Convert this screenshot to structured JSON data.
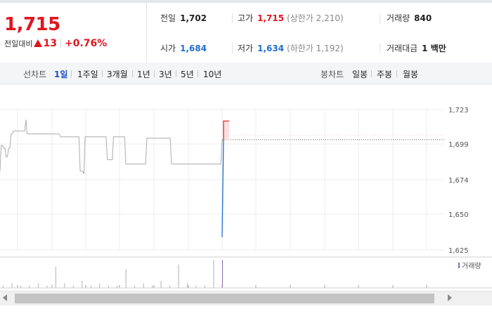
{
  "quote": {
    "price": "1,715",
    "change_label": "전일대비",
    "change_amount": "13",
    "change_pct": "+0.76%",
    "colors": {
      "up": "#e0151e",
      "down": "#1f6fd1"
    }
  },
  "stats": {
    "prev_close": {
      "label": "전일",
      "value": "1,702"
    },
    "high": {
      "label": "고가",
      "value": "1,715",
      "sub": "(상한가 2,210)"
    },
    "volume": {
      "label": "거래량",
      "value": "840"
    },
    "open": {
      "label": "시가",
      "value": "1,684"
    },
    "low": {
      "label": "저가",
      "value": "1,634",
      "sub": "(하한가 1,192)"
    },
    "amount": {
      "label": "거래대금",
      "value": "1 백만"
    }
  },
  "line_chart": {
    "label": "선차트",
    "periods": [
      {
        "label": "1일",
        "active": true
      },
      {
        "label": "1주일",
        "active": false
      },
      {
        "label": "3개월",
        "active": false
      },
      {
        "label": "1년",
        "active": false
      },
      {
        "label": "3년",
        "active": false
      },
      {
        "label": "5년",
        "active": false
      },
      {
        "label": "10년",
        "active": false
      }
    ]
  },
  "candle_chart": {
    "label": "봉차트",
    "periods": [
      {
        "label": "일봉"
      },
      {
        "label": "주봉"
      },
      {
        "label": "월봉"
      }
    ]
  },
  "volume_legend": "거래량",
  "chart_data": {
    "type": "line",
    "y_ticks": [
      "1,723",
      "1,699",
      "1,674",
      "1,650",
      "1,625"
    ],
    "ylim": [
      1625,
      1723
    ],
    "grid": true,
    "prev_close_reference": 1702,
    "series": [
      {
        "values": [
          1680,
          1698,
          1698,
          1696,
          1696,
          1690,
          1690,
          1696,
          1696,
          1706,
          1706,
          1708,
          1708,
          1708,
          1708,
          1708,
          1708,
          1708,
          1708,
          1708,
          1708,
          1716,
          1706,
          1706,
          1706,
          1706,
          1706,
          1706,
          1706,
          1706,
          1706,
          1706,
          1706,
          1706,
          1706,
          1706,
          1706,
          1706,
          1706,
          1706,
          1706,
          1706,
          1706,
          1706,
          1706,
          1706,
          1706,
          1706,
          1706,
          1704,
          1704,
          1704,
          1704,
          1704,
          1704,
          1704,
          1704,
          1704,
          1704,
          1704,
          1704,
          1704,
          1704,
          1704,
          1704,
          1680,
          1680,
          1680,
          1678,
          1704,
          1704,
          1704,
          1704,
          1704,
          1704,
          1704,
          1704,
          1704,
          1704,
          1704,
          1704,
          1704,
          1704,
          1704,
          1704,
          1704,
          1704,
          1688,
          1688,
          1688,
          1688,
          1688,
          1704,
          1704,
          1704,
          1704,
          1704,
          1704,
          1704,
          1704,
          1704,
          1704,
          1685,
          1685,
          1685,
          1685,
          1685,
          1685,
          1685,
          1685,
          1685,
          1685,
          1685,
          1685,
          1685,
          1685,
          1685,
          1685,
          1685,
          1703,
          1703,
          1703,
          1703,
          1703,
          1703,
          1703,
          1703,
          1703,
          1703,
          1703,
          1703,
          1703,
          1703,
          1703,
          1703,
          1703,
          1703,
          1703,
          1703,
          1685,
          1685,
          1685,
          1685,
          1685,
          1685,
          1685,
          1685,
          1685,
          1685,
          1685,
          1685,
          1685,
          1685,
          1685,
          1685,
          1685,
          1685,
          1685,
          1685,
          1685,
          1685,
          1685,
          1685,
          1685,
          1685,
          1685,
          1685,
          1685,
          1685,
          1685,
          1685,
          1685,
          1685,
          1685,
          1685,
          1685,
          1685,
          1685,
          1685,
          1685,
          1702
        ]
      }
    ],
    "today_values": [
      1634,
      1702,
      1715
    ],
    "today_open": 1684,
    "volume_bars": [
      1,
      2,
      1,
      1,
      2,
      1,
      9,
      2,
      1,
      3,
      1,
      2,
      1,
      1,
      8,
      1,
      2,
      1,
      3,
      1,
      10,
      2,
      1,
      1,
      12
    ]
  }
}
